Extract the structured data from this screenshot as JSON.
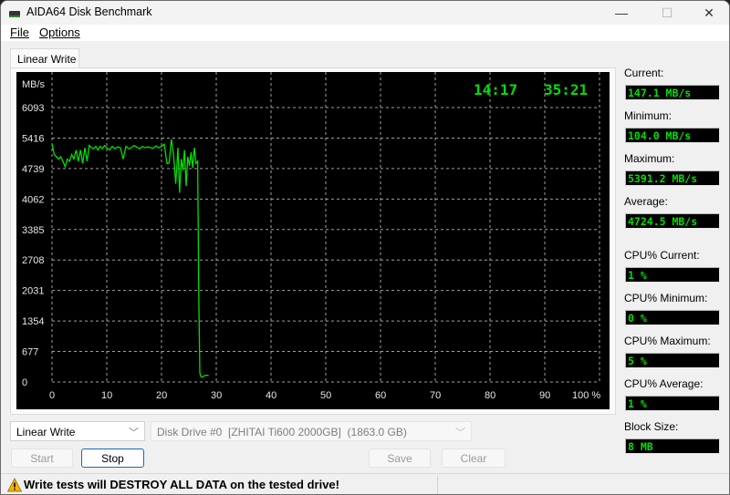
{
  "window": {
    "title": "AIDA64 Disk Benchmark",
    "controls": {
      "minimize": "—",
      "maximize": "☐",
      "close": "✕"
    }
  },
  "menu": {
    "file": "File",
    "options": "Options"
  },
  "tabs": [
    {
      "label": "Linear Write",
      "active": true
    }
  ],
  "chart_overlay": {
    "elapsed_time": "14:17",
    "remaining_time": "35:21"
  },
  "stats": [
    {
      "label": "Current:",
      "value": "147.1 MB/s"
    },
    {
      "label": "Minimum:",
      "value": "104.0 MB/s"
    },
    {
      "label": "Maximum:",
      "value": "5391.2 MB/s"
    },
    {
      "label": "Average:",
      "value": "4724.5 MB/s"
    },
    {
      "label": "CPU% Current:",
      "value": "1 %"
    },
    {
      "label": "CPU% Minimum:",
      "value": "0 %"
    },
    {
      "label": "CPU% Maximum:",
      "value": "5 %"
    },
    {
      "label": "CPU% Average:",
      "value": "1 %"
    },
    {
      "label": "Block Size:",
      "value": "8 MB"
    }
  ],
  "controls": {
    "test_select": {
      "value": "Linear Write"
    },
    "drive_select": {
      "value": "Disk Drive #0  [ZHITAI Ti600 2000GB]  (1863.0 GB)",
      "enabled": false
    },
    "start": {
      "label": "Start",
      "enabled": false
    },
    "stop": {
      "label": "Stop",
      "enabled": true
    },
    "save": {
      "label": "Save",
      "enabled": false
    },
    "clear": {
      "label": "Clear",
      "enabled": false
    }
  },
  "status": {
    "icon": "warning-icon",
    "text": "Write tests will DESTROY ALL DATA on the tested drive!"
  },
  "colors": {
    "line": "#00e000",
    "grid": "#a0a0a0",
    "readout": "#00e000",
    "background": "#000000"
  },
  "chart_data": {
    "type": "line",
    "title": "",
    "ylabel": "MB/s",
    "xlabel": "%",
    "ylim": [
      0,
      6093
    ],
    "xlim": [
      0,
      100
    ],
    "grid": true,
    "y_ticks": [
      0,
      677,
      1354,
      2031,
      2708,
      3385,
      4062,
      4739,
      5416,
      6093
    ],
    "x_ticks": [
      0,
      10,
      20,
      30,
      40,
      50,
      60,
      70,
      80,
      90,
      100
    ],
    "x_tick_labels": [
      "0",
      "10",
      "20",
      "30",
      "40",
      "50",
      "60",
      "70",
      "80",
      "90",
      "100 %"
    ],
    "series": [
      {
        "name": "Linear Write",
        "x": [
          0,
          0.4,
          0.8,
          1.2,
          1.6,
          2.0,
          2.4,
          2.8,
          3.2,
          3.6,
          4.0,
          4.4,
          4.8,
          5.2,
          5.6,
          6.0,
          6.4,
          6.8,
          7.2,
          7.6,
          8.0,
          8.4,
          8.8,
          9.2,
          9.6,
          10.0,
          10.5,
          11.0,
          11.5,
          12.0,
          12.5,
          13.0,
          13.5,
          14.0,
          14.5,
          15.0,
          15.5,
          16.0,
          16.5,
          17.0,
          17.5,
          18.0,
          18.5,
          19.0,
          19.5,
          20.0,
          20.5,
          21.0,
          21.4,
          21.8,
          22.2,
          22.6,
          23.0,
          23.3,
          23.6,
          23.9,
          24.2,
          24.5,
          24.8,
          25.1,
          25.4,
          25.7,
          26.0,
          26.3,
          26.6,
          26.8,
          27.0,
          27.2,
          27.5,
          27.8,
          28.2,
          28.6
        ],
        "y": [
          5300,
          5050,
          5000,
          4950,
          5000,
          4900,
          4780,
          4950,
          4900,
          5050,
          4950,
          5150,
          4900,
          5150,
          4850,
          5200,
          4900,
          5250,
          5200,
          5180,
          5230,
          5150,
          5230,
          5180,
          5250,
          5200,
          5150,
          5230,
          5180,
          5220,
          5200,
          4950,
          5230,
          5180,
          5200,
          5250,
          5210,
          5180,
          5230,
          5200,
          5220,
          5200,
          5190,
          5240,
          5200,
          5230,
          5280,
          4850,
          4860,
          5390,
          5050,
          4400,
          5200,
          4200,
          4950,
          4700,
          5150,
          4350,
          5000,
          4800,
          5100,
          4750,
          5200,
          4850,
          4900,
          2000,
          200,
          120,
          104,
          140,
          147,
          147
        ]
      }
    ]
  }
}
